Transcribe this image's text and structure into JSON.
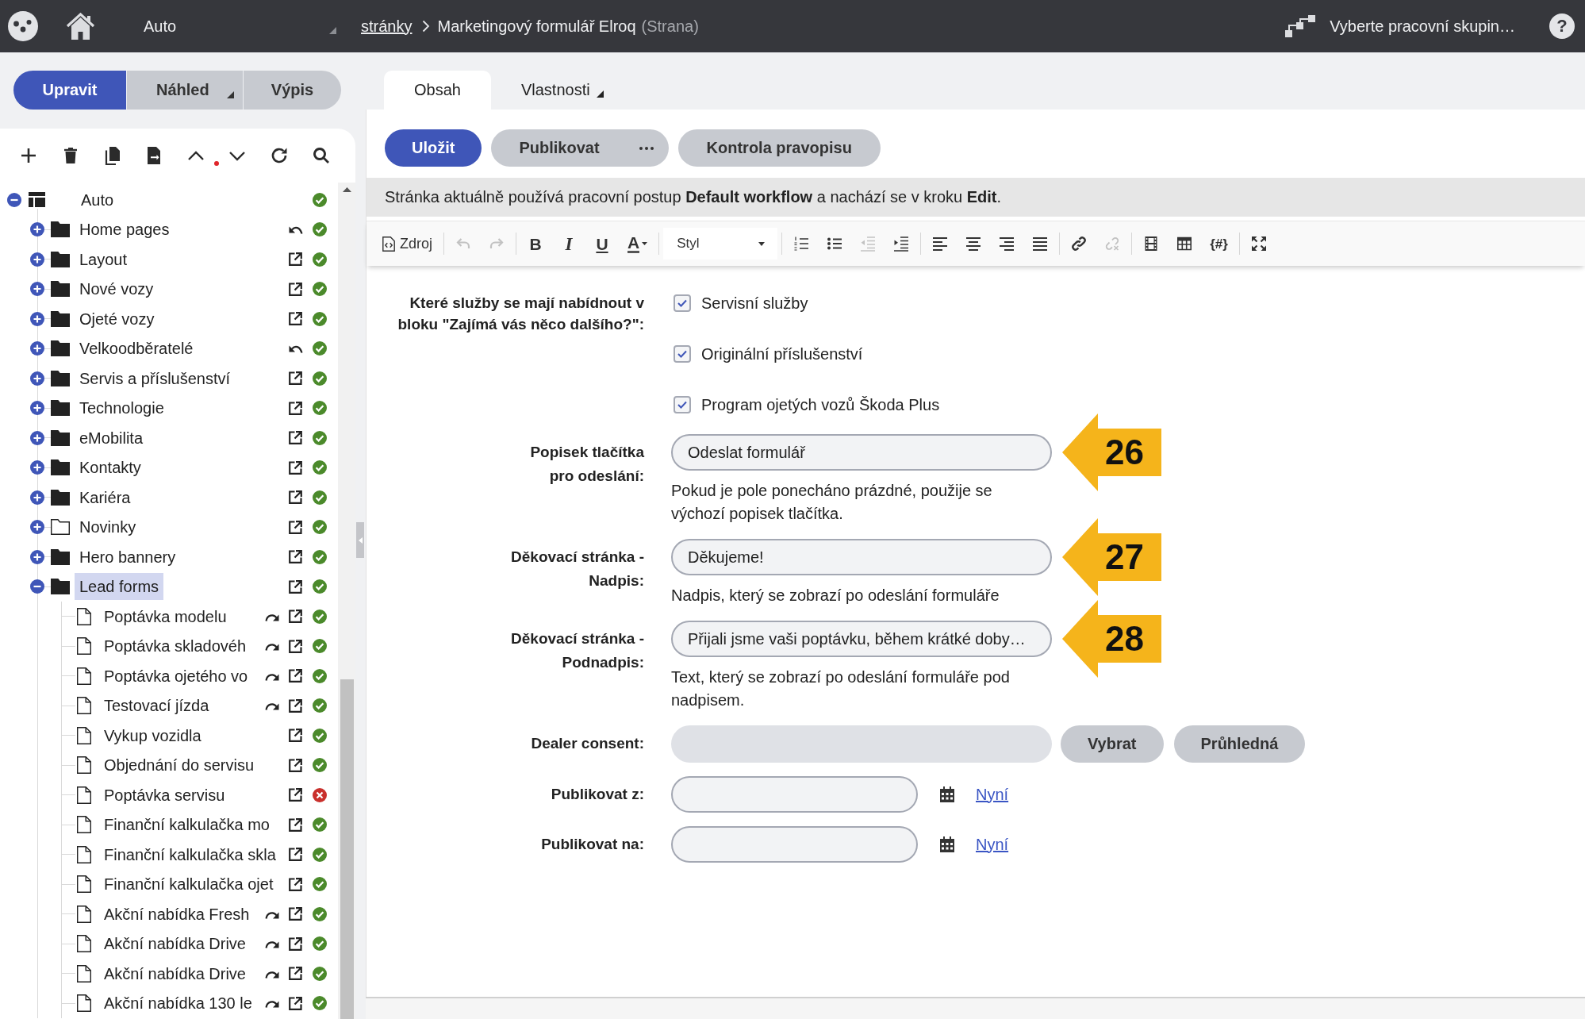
{
  "topbar": {
    "site": "Auto",
    "breadcrumb_link": "stránky",
    "page_title": "Marketingový formulář Elroq",
    "page_type": "(Strana)",
    "workgroup": "Vyberte pracovní skupin…",
    "help": "?"
  },
  "mode_tabs": [
    {
      "label": "Upravit",
      "selected": true,
      "dropdown": false
    },
    {
      "label": "Náhled",
      "selected": false,
      "dropdown": true
    },
    {
      "label": "Výpis",
      "selected": false,
      "dropdown": false
    }
  ],
  "tree": {
    "items": [
      {
        "label": "Auto",
        "kind": "site",
        "expanded": true,
        "selected": false,
        "published": true,
        "children": [
          {
            "label": "Home pages",
            "kind": "folder",
            "filled": true,
            "expanded": false,
            "selected": false,
            "restore": true,
            "external": false,
            "published": true
          },
          {
            "label": "Layout",
            "kind": "folder",
            "filled": true,
            "expanded": false,
            "selected": false,
            "restore": false,
            "external": true,
            "published": true
          },
          {
            "label": "Nové vozy",
            "kind": "folder",
            "filled": true,
            "expanded": false,
            "selected": false,
            "restore": false,
            "external": true,
            "published": true
          },
          {
            "label": "Ojeté vozy",
            "kind": "folder",
            "filled": true,
            "expanded": false,
            "selected": false,
            "restore": false,
            "external": true,
            "published": true
          },
          {
            "label": "Velkoodběratelé",
            "kind": "folder",
            "filled": true,
            "expanded": false,
            "selected": false,
            "restore": true,
            "external": false,
            "published": true
          },
          {
            "label": "Servis a příslušenství",
            "kind": "folder",
            "filled": true,
            "expanded": false,
            "selected": false,
            "restore": false,
            "external": true,
            "published": true
          },
          {
            "label": "Technologie",
            "kind": "folder",
            "filled": true,
            "expanded": false,
            "selected": false,
            "restore": false,
            "external": true,
            "published": true
          },
          {
            "label": "eMobilita",
            "kind": "folder",
            "filled": true,
            "expanded": false,
            "selected": false,
            "restore": false,
            "external": true,
            "published": true
          },
          {
            "label": "Kontakty",
            "kind": "folder",
            "filled": true,
            "expanded": false,
            "selected": false,
            "restore": false,
            "external": true,
            "published": true
          },
          {
            "label": "Kariéra",
            "kind": "folder",
            "filled": true,
            "expanded": false,
            "selected": false,
            "restore": false,
            "external": true,
            "published": true
          },
          {
            "label": "Novinky",
            "kind": "folder",
            "filled": false,
            "expanded": false,
            "selected": false,
            "restore": false,
            "external": true,
            "published": true
          },
          {
            "label": "Hero bannery",
            "kind": "folder",
            "filled": true,
            "expanded": false,
            "selected": false,
            "restore": false,
            "external": true,
            "published": true
          },
          {
            "label": "Lead forms",
            "kind": "folder",
            "filled": true,
            "expanded": true,
            "selected": true,
            "restore": false,
            "external": true,
            "published": true,
            "children": [
              {
                "label": "Poptávka modelu",
                "kind": "page",
                "selected": false,
                "redirect": true,
                "external": true,
                "published": true
              },
              {
                "label": "Poptávka skladovéh",
                "kind": "page",
                "selected": false,
                "redirect": true,
                "external": true,
                "published": true
              },
              {
                "label": "Poptávka ojetého vo",
                "kind": "page",
                "selected": false,
                "redirect": true,
                "external": true,
                "published": true
              },
              {
                "label": "Testovací jízda",
                "kind": "page",
                "selected": false,
                "redirect": true,
                "external": true,
                "published": true
              },
              {
                "label": "Vykup vozidla",
                "kind": "page",
                "selected": false,
                "redirect": false,
                "external": true,
                "published": true
              },
              {
                "label": "Objednání do servisu",
                "kind": "page",
                "selected": false,
                "redirect": false,
                "external": true,
                "published": true
              },
              {
                "label": "Poptávka servisu",
                "kind": "page",
                "selected": false,
                "redirect": false,
                "external": true,
                "published": false
              },
              {
                "label": "Finanční kalkulačka mo",
                "kind": "page",
                "selected": false,
                "redirect": false,
                "external": true,
                "published": true
              },
              {
                "label": "Finanční kalkulačka skla",
                "kind": "page",
                "selected": false,
                "redirect": false,
                "external": true,
                "published": true
              },
              {
                "label": "Finanční kalkulačka ojet",
                "kind": "page",
                "selected": false,
                "redirect": false,
                "external": true,
                "published": true
              },
              {
                "label": "Akční nabídka Fresh",
                "kind": "page",
                "selected": false,
                "redirect": true,
                "external": true,
                "published": true
              },
              {
                "label": "Akční nabídka Drive",
                "kind": "page",
                "selected": false,
                "redirect": true,
                "external": true,
                "published": true
              },
              {
                "label": "Akční nabídka Drive",
                "kind": "page",
                "selected": false,
                "redirect": true,
                "external": true,
                "published": true
              },
              {
                "label": "Akční nabídka 130 le",
                "kind": "page",
                "selected": false,
                "redirect": true,
                "external": true,
                "published": true
              }
            ]
          }
        ]
      }
    ]
  },
  "content_tabs": [
    {
      "label": "Obsah",
      "selected": true,
      "dropdown": false
    },
    {
      "label": "Vlastnosti",
      "selected": false,
      "dropdown": true
    }
  ],
  "actions": [
    {
      "label": "Uložit",
      "kind": "primary"
    },
    {
      "label": "Publikovat",
      "kind": "split"
    },
    {
      "label": "Kontrola pravopisu",
      "kind": "secondary"
    }
  ],
  "workflow_notice": "Stránka aktuálně používá pracovní postup **Default workflow** a nachází se v kroku **Edit**.",
  "editor_toolbar": {
    "groups": [
      [
        {
          "kind": "source",
          "label": "Zdroj",
          "disabled": false
        }
      ],
      [
        {
          "kind": "undo",
          "disabled": true
        },
        {
          "kind": "redo",
          "disabled": true
        }
      ],
      [
        {
          "kind": "bold",
          "glyph": "B",
          "disabled": false
        },
        {
          "kind": "italic",
          "glyph": "I",
          "disabled": false
        },
        {
          "kind": "underline",
          "glyph": "U",
          "disabled": false
        },
        {
          "kind": "textcolor",
          "glyph": "A",
          "disabled": false
        }
      ],
      [
        {
          "kind": "style",
          "label": "Styl",
          "disabled": false
        }
      ],
      [
        {
          "kind": "numbered",
          "disabled": false
        },
        {
          "kind": "bulleted",
          "disabled": false
        },
        {
          "kind": "outdent",
          "disabled": true
        },
        {
          "kind": "indent",
          "disabled": false
        }
      ],
      [
        {
          "kind": "alignleft",
          "disabled": false
        },
        {
          "kind": "aligncenter",
          "disabled": false
        },
        {
          "kind": "alignright",
          "disabled": false
        },
        {
          "kind": "justify",
          "disabled": false
        }
      ],
      [
        {
          "kind": "link",
          "disabled": false
        },
        {
          "kind": "unlink",
          "disabled": true
        }
      ],
      [
        {
          "kind": "media",
          "disabled": false
        },
        {
          "kind": "table",
          "disabled": false
        },
        {
          "kind": "placeholder",
          "glyph": "{#}",
          "disabled": false
        }
      ],
      [
        {
          "kind": "maximize",
          "disabled": false
        }
      ]
    ]
  },
  "form": {
    "rows": [
      {
        "kind": "checkboxes",
        "label": [
          "Které služby se mají nabídnout v",
          "bloku \"Zajímá vás něco dalšího?\":"
        ],
        "options": [
          {
            "label": "Servisní služby",
            "checked": true
          },
          {
            "label": "Originální příslušenství",
            "checked": true
          },
          {
            "label": "Program ojetých vozů Škoda Plus",
            "checked": true
          }
        ]
      },
      {
        "kind": "text",
        "label": [
          "Popisek tlačítka",
          "pro odeslání:"
        ],
        "value": "Odeslat formulář",
        "hint": "Pokud je pole ponecháno prázdné, použije se výchozí popisek tlačítka.",
        "callout": "26"
      },
      {
        "kind": "text",
        "label": [
          "Děkovací stránka -",
          "Nadpis:"
        ],
        "value": "Děkujeme!",
        "hint": "Nadpis, který se zobrazí po odeslání formuláře",
        "callout": "27"
      },
      {
        "kind": "text",
        "label": [
          "Děkovací stránka -",
          "Podnadpis:"
        ],
        "value": "Přijali jsme vaši poptávku, během krátké doby…",
        "hint": "Text, který se zobrazí po odeslání formuláře pod nadpisem.",
        "callout": "28"
      },
      {
        "kind": "picker",
        "label": [
          "Dealer consent:"
        ],
        "disabled": true,
        "buttons": [
          {
            "label": "Vybrat"
          },
          {
            "label": "Průhledná"
          }
        ]
      },
      {
        "kind": "date",
        "label": [
          "Publikovat z:"
        ],
        "link": "Nyní"
      },
      {
        "kind": "date",
        "label": [
          "Publikovat na:"
        ],
        "link": "Nyní"
      }
    ]
  }
}
